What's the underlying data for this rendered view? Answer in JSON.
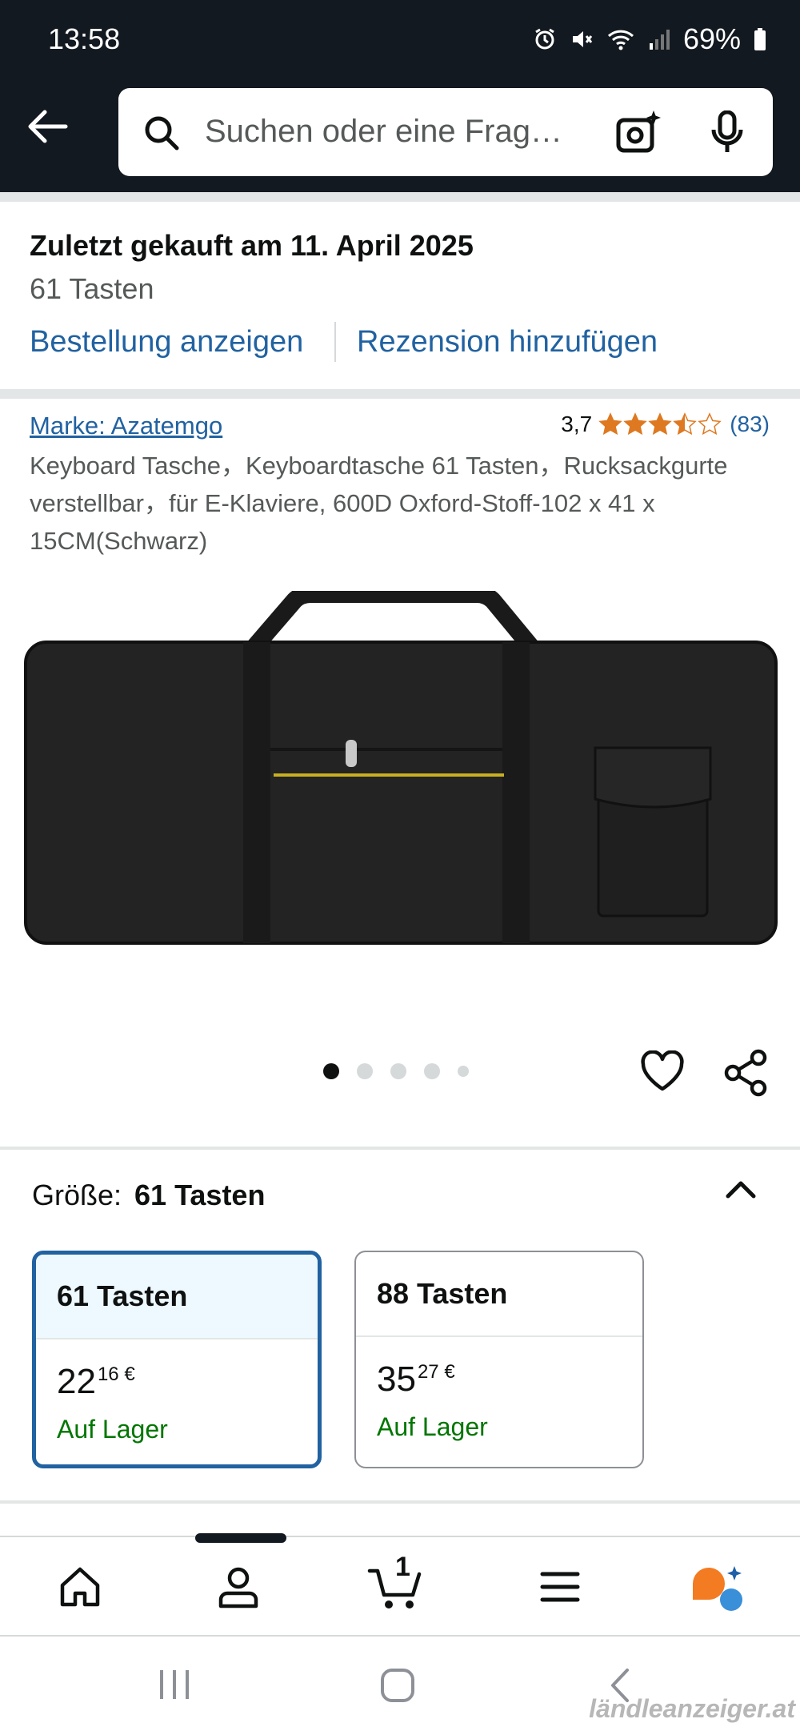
{
  "status_bar": {
    "time": "13:58",
    "battery": "69%"
  },
  "search": {
    "placeholder": "Suchen oder eine Frag…"
  },
  "purchase": {
    "title": "Zuletzt gekauft am 11. April 2025",
    "subtitle": "61 Tasten",
    "view_order": "Bestellung anzeigen",
    "add_review": "Rezension hinzufügen"
  },
  "product": {
    "brand": "Marke: Azatemgo",
    "rating": "3,7",
    "stars": 3.7,
    "reviews": "(83)",
    "title": "Keyboard Tasche，Keyboardtasche 61 Tasten，Rucksackgurte verstellbar，für E-Klaviere, 600D Oxford-Stoff-102 x 41 x 15CM(Schwarz)",
    "image_count": 5,
    "active_image": 1
  },
  "size": {
    "label": "Größe:",
    "selected": "61 Tasten",
    "options": [
      {
        "name": "61 Tasten",
        "price_whole": "22",
        "price_fraction": "16 €",
        "stock": "Auf Lager"
      },
      {
        "name": "88 Tasten",
        "price_whole": "35",
        "price_fraction": "27 €",
        "stock": "Auf Lager"
      }
    ]
  },
  "bottom_nav": {
    "cart_count": "1"
  },
  "watermark": "ländleanzeiger.at",
  "colors": {
    "header_bg": "#131921",
    "link": "#2162a1",
    "stock": "#007600",
    "star": "#de7921",
    "selected_border": "#2162a1"
  }
}
